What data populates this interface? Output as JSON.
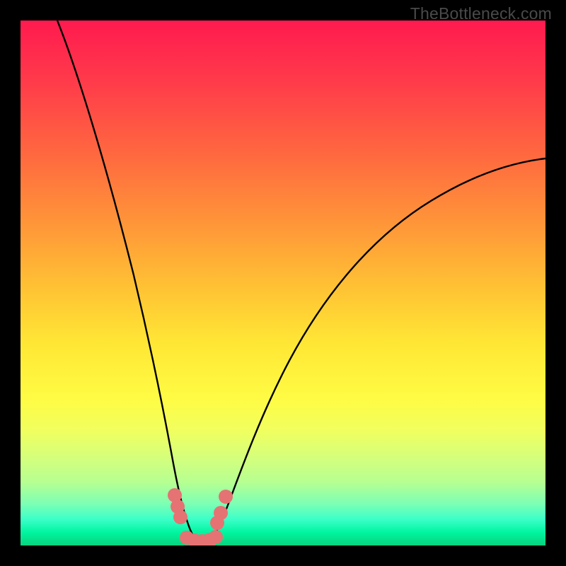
{
  "watermark": "TheBottleneck.com",
  "colors": {
    "frame": "#000000",
    "gradient_top": "#ff1a4f",
    "gradient_mid": "#ffe835",
    "gradient_bottom": "#07d47e",
    "curve": "#000000",
    "bead": "#e57373"
  },
  "chart_data": {
    "type": "line",
    "title": "",
    "xlabel": "",
    "ylabel": "",
    "xlim": [
      0,
      100
    ],
    "ylim": [
      0,
      100
    ],
    "series": [
      {
        "name": "left-curve",
        "x": [
          7,
          10,
          13,
          16,
          19,
          22,
          25,
          27,
          28,
          29,
          30,
          31,
          32,
          33
        ],
        "y": [
          100,
          88,
          76,
          64,
          52,
          40,
          27,
          17,
          12,
          8,
          5,
          3,
          1.5,
          0.7
        ]
      },
      {
        "name": "right-curve",
        "x": [
          35,
          36,
          37,
          38,
          40,
          43,
          47,
          52,
          58,
          65,
          73,
          82,
          92,
          100
        ],
        "y": [
          0.7,
          1.5,
          3,
          5,
          9,
          16,
          25,
          34,
          43,
          51,
          58,
          64,
          69,
          72
        ]
      },
      {
        "name": "valley-floor",
        "x": [
          31,
          32,
          33,
          34,
          35,
          36,
          37
        ],
        "y": [
          0.6,
          0.5,
          0.5,
          0.5,
          0.5,
          0.6,
          0.8
        ]
      }
    ],
    "annotations": {
      "beads_left": [
        {
          "x": 29.2,
          "y": 9.8
        },
        {
          "x": 29.7,
          "y": 7.6
        },
        {
          "x": 30.2,
          "y": 5.6
        }
      ],
      "beads_right": [
        {
          "x": 37.2,
          "y": 4.4
        },
        {
          "x": 37.8,
          "y": 6.4
        },
        {
          "x": 38.8,
          "y": 9.6
        }
      ],
      "beads_floor": [
        {
          "x": 31.5,
          "y": 1.3
        },
        {
          "x": 32.8,
          "y": 0.9
        },
        {
          "x": 34.0,
          "y": 0.8
        },
        {
          "x": 35.2,
          "y": 0.9
        },
        {
          "x": 36.3,
          "y": 1.4
        }
      ]
    }
  }
}
